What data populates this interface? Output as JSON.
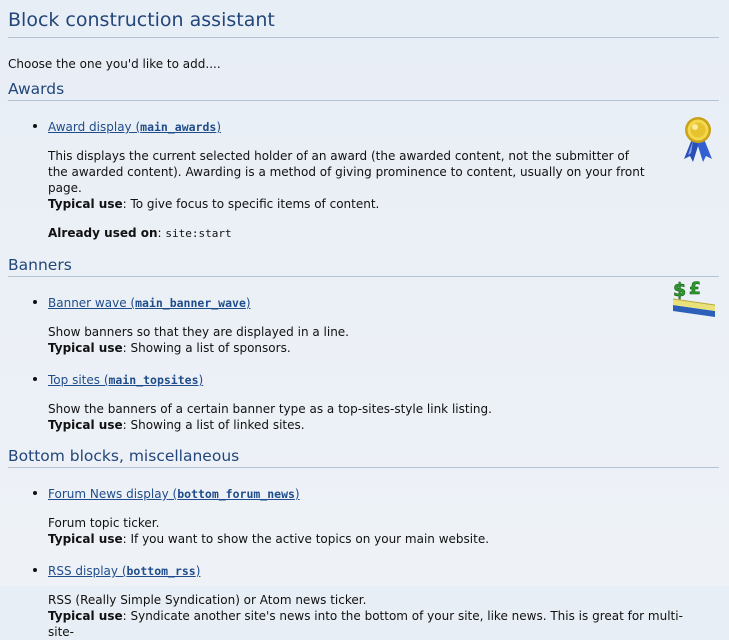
{
  "page": {
    "title": "Block construction assistant",
    "intro": "Choose the one you'd like to add...."
  },
  "labels": {
    "typical_use": "Typical use",
    "already_used_on": "Already used on"
  },
  "sections": [
    {
      "heading": "Awards",
      "icon": "award-ribbon-icon",
      "blocks": [
        {
          "name": "Award display",
          "code": "main_awards",
          "description": "This displays the current selected holder of an award (the awarded content, not the submitter of the awarded content). Awarding is a method of giving prominence to content, usually on your front page.",
          "typical_use": "To give focus to specific items of content.",
          "used_on": "site:start"
        }
      ]
    },
    {
      "heading": "Banners",
      "icon": "banner-money-icon",
      "blocks": [
        {
          "name": "Banner wave",
          "code": "main_banner_wave",
          "description": "Show banners so that they are displayed in a line.",
          "typical_use": "Showing a list of sponsors."
        },
        {
          "name": "Top sites",
          "code": "main_topsites",
          "description": "Show the banners of a certain banner type as a top-sites-style link listing.",
          "typical_use": "Showing a list of linked sites."
        }
      ]
    },
    {
      "heading": "Bottom blocks, miscellaneous",
      "blocks": [
        {
          "name": "Forum News display",
          "code": "bottom_forum_news",
          "description": "Forum topic ticker.",
          "typical_use": "If you want to show the active topics on your main website."
        },
        {
          "name": "RSS display",
          "code": "bottom_rss",
          "description": "RSS (Really Simple Syndication) or Atom news ticker.",
          "typical_use": "Syndicate another site's news into the bottom of your site, like news. This is great for multi-site-"
        }
      ]
    }
  ]
}
